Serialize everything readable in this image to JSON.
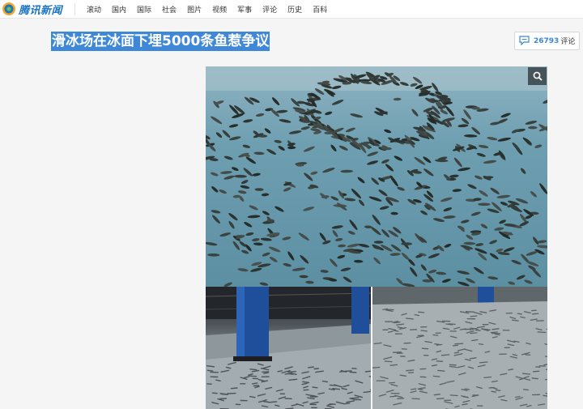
{
  "brand": {
    "name": "腾讯新闻",
    "logo_icon": "tencent-news-logo-icon",
    "accent": "#1a74c4"
  },
  "nav": {
    "items": [
      {
        "label": "滚动"
      },
      {
        "label": "国内"
      },
      {
        "label": "国际"
      },
      {
        "label": "社会"
      },
      {
        "label": "图片"
      },
      {
        "label": "视频"
      },
      {
        "label": "军事"
      },
      {
        "label": "评论"
      },
      {
        "label": "历史"
      },
      {
        "label": "百科"
      }
    ]
  },
  "article": {
    "title": "滑冰场在冰面下埋5000条鱼惹争议",
    "title_highlight_color": "#3f88d8"
  },
  "comments": {
    "count": "26793",
    "label": "评论",
    "icon": "comment-bubble-icon",
    "count_color": "#3a88d2"
  },
  "gallery": {
    "zoom_icon": "magnifier-icon",
    "images": [
      {
        "name": "fish-under-ice-closeup"
      },
      {
        "name": "rink-with-blue-pillar"
      },
      {
        "name": "rink-overview"
      }
    ]
  }
}
